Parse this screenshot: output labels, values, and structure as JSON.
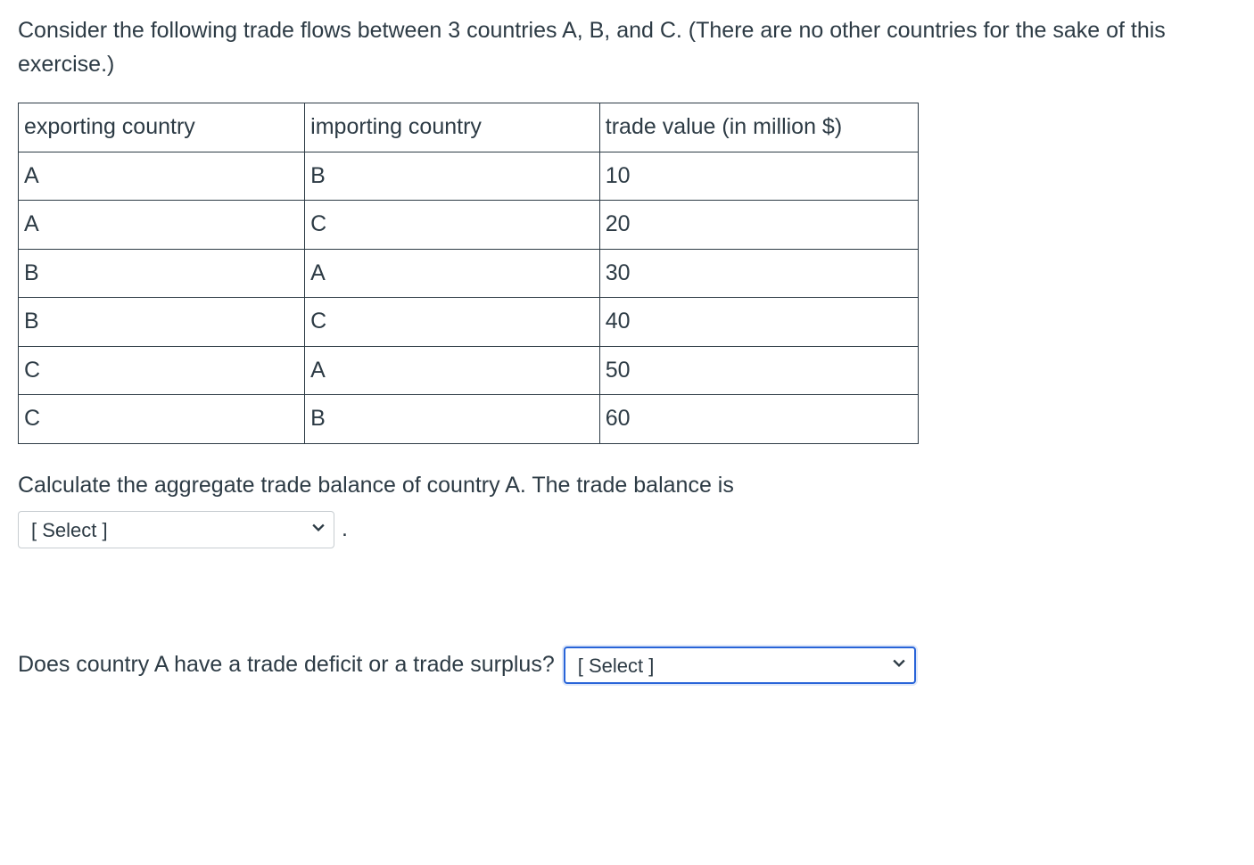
{
  "intro": "Consider the following trade flows between 3 countries A, B, and C. (There are no other countries for the sake of this exercise.)",
  "table": {
    "headers": {
      "exporting": "exporting country",
      "importing": "importing country",
      "value": "trade value (in million $)"
    },
    "rows": [
      {
        "exporting": "A",
        "importing": "B",
        "value": "10"
      },
      {
        "exporting": "A",
        "importing": "C",
        "value": "20"
      },
      {
        "exporting": "B",
        "importing": "A",
        "value": "30"
      },
      {
        "exporting": "B",
        "importing": "C",
        "value": "40"
      },
      {
        "exporting": "C",
        "importing": "A",
        "value": "50"
      },
      {
        "exporting": "C",
        "importing": "B",
        "value": "60"
      }
    ]
  },
  "q1": {
    "prompt": "Calculate the aggregate trade balance of country A. The trade balance is",
    "select_placeholder": "[ Select ]",
    "period": "."
  },
  "q2": {
    "prompt": "Does country A have a trade deficit or a trade surplus?",
    "select_placeholder": "[ Select ]"
  }
}
